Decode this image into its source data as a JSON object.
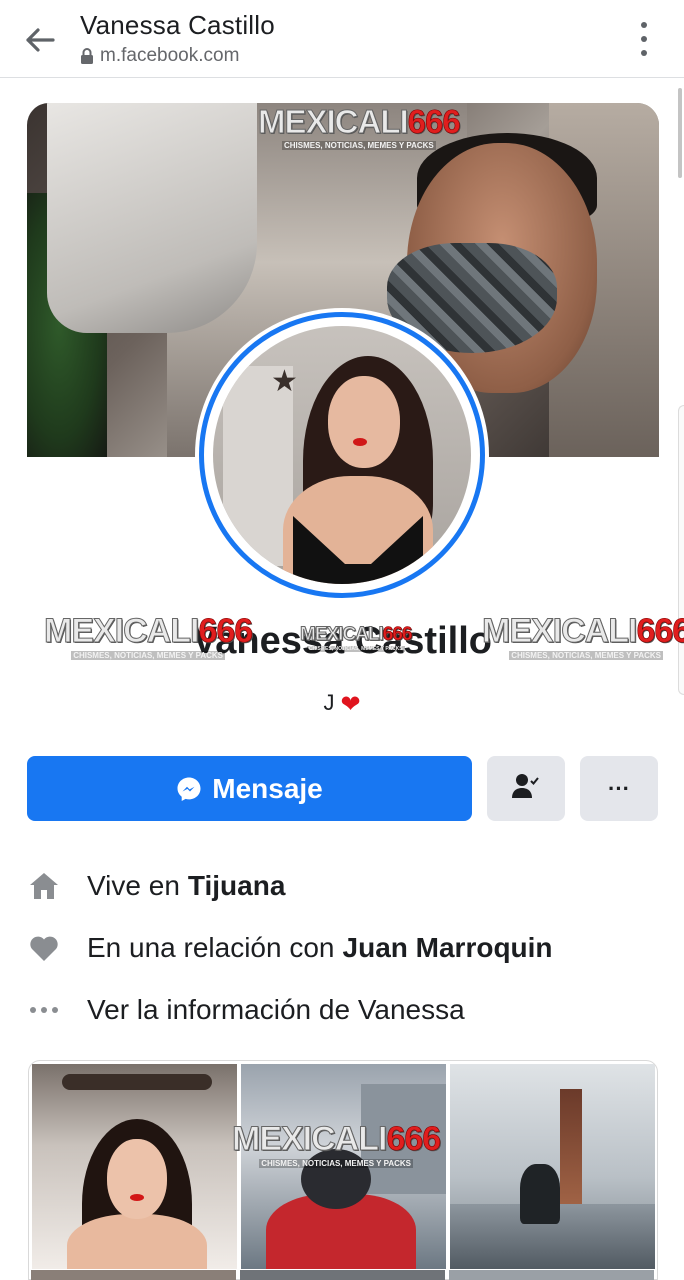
{
  "browser": {
    "title": "Vanessa Castillo",
    "url": "m.facebook.com"
  },
  "watermark": {
    "brand": "MEXICALI",
    "number": "666",
    "tagline": "CHISMES, NOTICIAS, MEMES Y PACKS"
  },
  "profile": {
    "name": "Vanessa Castillo",
    "bio": "J"
  },
  "actions": {
    "message_label": "Mensaje",
    "more_label": "···"
  },
  "info": {
    "lives_prefix": "Vive en",
    "lives_city": "Tijuana",
    "relationship_prefix": "En una relación con",
    "relationship_partner": "Juan Marroquin",
    "see_more": "Ver la información de Vanessa"
  },
  "colors": {
    "accent": "#1877f2",
    "button_gray": "#e4e6eb",
    "heart": "#e0141e"
  },
  "icons": [
    "back-arrow-icon",
    "lock-icon",
    "kebab-menu-icon",
    "messenger-icon",
    "friend-check-icon",
    "home-icon",
    "heart-icon",
    "ellipsis-icon"
  ]
}
